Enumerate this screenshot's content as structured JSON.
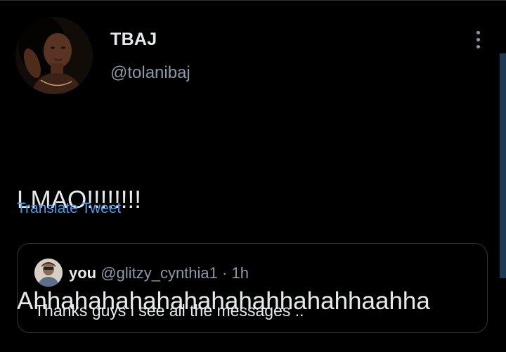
{
  "tweet": {
    "author": {
      "display_name": "TBAJ",
      "handle": "@tolanibaj",
      "avatar_icon": "profile-photo"
    },
    "text_lines": [
      "LMAO!!!!!!!!",
      "Ahhahahahahahahahahhahahhaahha"
    ],
    "translate_label": "Translate Tweet",
    "more_icon": "vertical-ellipsis-icon"
  },
  "quoted_tweet": {
    "author_name": "you",
    "handle": "@glitzy_cynthia1",
    "separator": "·",
    "time": "1h",
    "text": "Thanks guys i see all the messages .."
  },
  "colors": {
    "background": "#000000",
    "text_primary": "#e7e9ea",
    "text_secondary": "#8b98a5",
    "link": "#4a99e9",
    "border": "#2f3336"
  }
}
